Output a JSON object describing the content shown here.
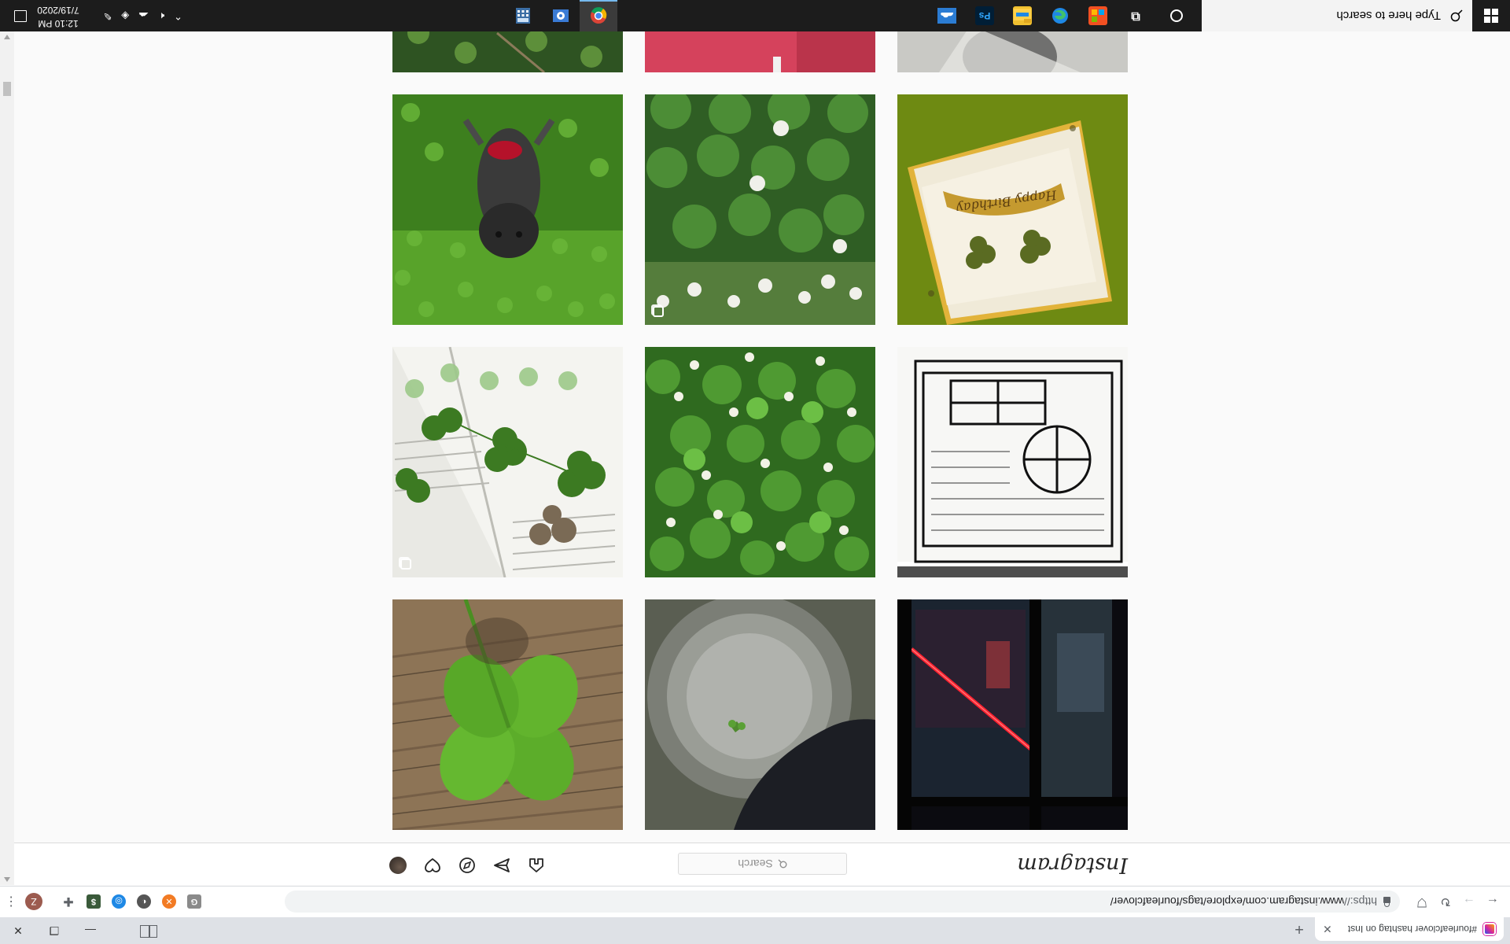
{
  "browser": {
    "tab_title": "#fourleafclover hashtag on Inst",
    "url_scheme": "https://",
    "url_rest": "www.instagram.com/explore/tags/fourleafclover/",
    "profile_initial": "Z"
  },
  "instagram": {
    "logo_text": "Instagram",
    "search_placeholder": "Search",
    "nav_icons": [
      "home-icon",
      "direct-icon",
      "explore-icon",
      "activity-icon",
      "profile-avatar"
    ]
  },
  "posts": [
    {
      "id": "post-grid-1",
      "desc": "red-lit city window at night",
      "multiple": false
    },
    {
      "id": "post-grid-2",
      "desc": "dark cat by metal bowl with clover",
      "multiple": false
    },
    {
      "id": "post-grid-3",
      "desc": "four leaf clover on wood",
      "multiple": false
    },
    {
      "id": "post-grid-4",
      "desc": "ink sketch of building window",
      "multiple": false
    },
    {
      "id": "post-grid-5",
      "desc": "clover patch with white flowers",
      "multiple": false
    },
    {
      "id": "post-grid-6",
      "desc": "pressed clovers on book pages",
      "multiple": true
    },
    {
      "id": "post-grid-7",
      "desc": "happy birthday card with clovers",
      "multiple": false
    },
    {
      "id": "post-grid-8",
      "desc": "clover leaves and white blossoms",
      "multiple": true
    },
    {
      "id": "post-grid-9",
      "desc": "dog in field of clover",
      "multiple": false
    },
    {
      "id": "post-grid-10",
      "desc": "blurred glass",
      "multiple": false
    },
    {
      "id": "post-grid-11",
      "desc": "red fabric",
      "multiple": false
    },
    {
      "id": "post-grid-12",
      "desc": "grass and clover",
      "multiple": false
    }
  ],
  "card_text": "Happy Birthday",
  "taskbar": {
    "search_placeholder": "Type here to search",
    "time": "12:10 PM",
    "date": "7/19/2020",
    "apps": [
      "task-view-icon",
      "microsoft-store-icon",
      "edge-icon",
      "file-explorer-icon",
      "photoshop-icon",
      "onedrive-icon",
      "chrome-icon",
      "control-panel-icon",
      "calculator-icon"
    ]
  }
}
